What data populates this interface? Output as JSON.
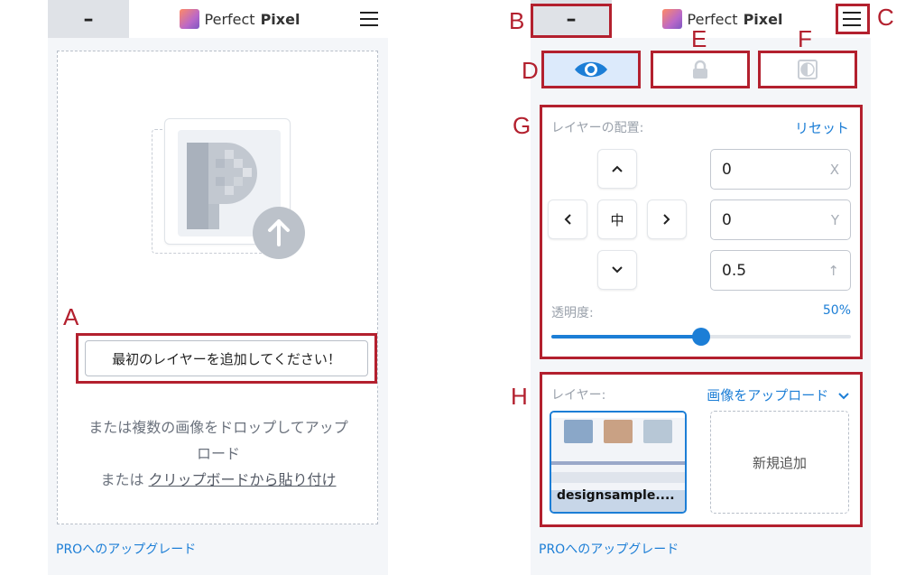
{
  "colors": {
    "accent": "#1c7ed6",
    "annotation": "#b3202e"
  },
  "annotations": {
    "a": "A",
    "b": "B",
    "c": "C",
    "d": "D",
    "e": "E",
    "f": "F",
    "g": "G",
    "h": "H"
  },
  "left_panel": {
    "header": {
      "minimize_label": "–",
      "logo_text": "Perfect",
      "logo_bold": "Pixel"
    },
    "add_layer_button": "最初のレイヤーを追加してください！",
    "drop_line1": "または複数の画像をドロップしてアップ",
    "drop_line2": "ロード",
    "drop_line3_prefix": "または ",
    "clipboard_link": "クリップボードから貼り付け",
    "pro_link": "PROへのアップグレード"
  },
  "right_panel": {
    "header": {
      "minimize_label": "–",
      "logo_text": "Perfect",
      "logo_bold": "Pixel"
    },
    "tabs": {
      "active": "visibility"
    },
    "position": {
      "label": "レイヤーの配置:",
      "reset": "リセット",
      "up": "^",
      "left": "<",
      "center": "中",
      "right": ">",
      "down": "v",
      "x_value": "0",
      "x_unit": "X",
      "y_value": "0",
      "y_unit": "Y",
      "scale_value": "0.5",
      "scale_unit": "↑"
    },
    "opacity": {
      "label": "透明度:",
      "value_text": "50%",
      "value": 0.5
    },
    "layers": {
      "label": "レイヤー:",
      "upload": "画像をアップロード",
      "thumb_name": "designsample....",
      "new_layer": "新規追加"
    },
    "pro_link": "PROへのアップグレード"
  }
}
